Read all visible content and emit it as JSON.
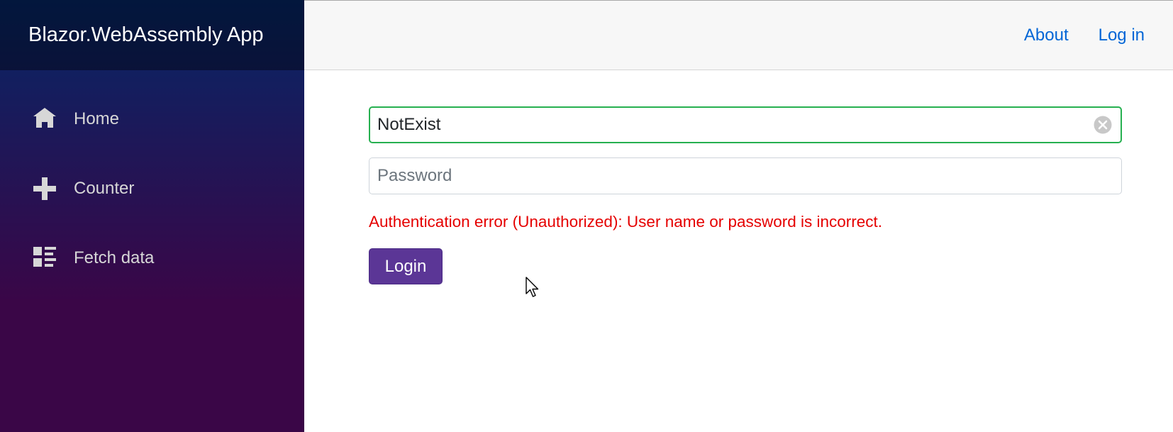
{
  "app": {
    "brand": "Blazor.WebAssembly App"
  },
  "sidebar": {
    "items": [
      {
        "label": "Home",
        "icon": "home-icon"
      },
      {
        "label": "Counter",
        "icon": "plus-icon"
      },
      {
        "label": "Fetch data",
        "icon": "list-rich-icon"
      }
    ]
  },
  "topbar": {
    "about": "About",
    "login": "Log in"
  },
  "form": {
    "username_value": "NotExist",
    "password_placeholder": "Password",
    "error": "Authentication error (Unauthorized): User name or password is incorrect.",
    "submit_label": "Login"
  },
  "colors": {
    "sidebar_gradient_start": "#052767",
    "sidebar_gradient_end": "#3a0647",
    "link": "#0366d6",
    "error": "#e50000",
    "button": "#5b3696",
    "valid_border": "#26b050"
  }
}
